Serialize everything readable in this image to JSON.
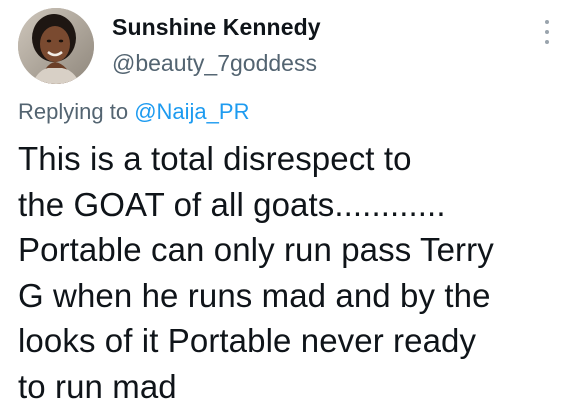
{
  "author": {
    "display_name": "Sunshine Kennedy",
    "handle": "@beauty_7goddess"
  },
  "reply": {
    "prefix": "Replying to",
    "mention": "@Naija_PR"
  },
  "tweet": {
    "lines": [
      "This is a total disrespect to",
      "the GOAT of all goats............",
      "Portable can only run pass Terry",
      "G when he runs mad and by the",
      "looks of it Portable never ready",
      "to run mad"
    ]
  },
  "icons": {
    "more": "more-vertical-icon",
    "avatar": "profile-avatar"
  },
  "colors": {
    "text": "#0f1419",
    "secondary": "#536471",
    "link": "#1d9bf0"
  }
}
